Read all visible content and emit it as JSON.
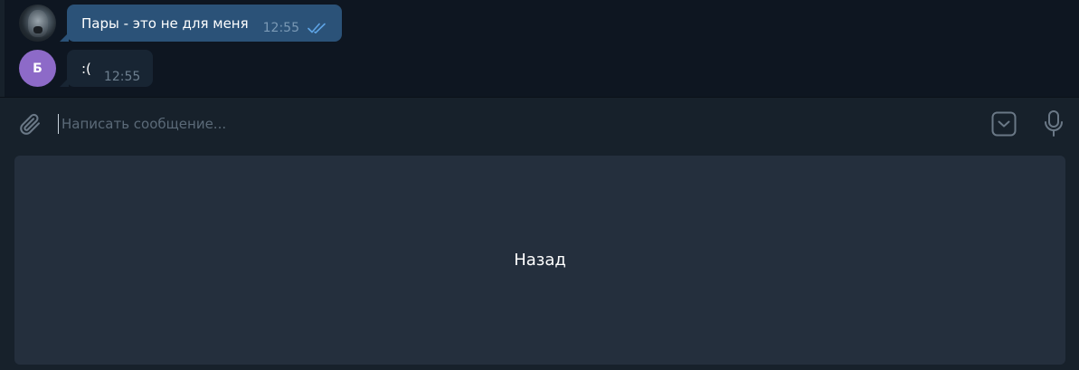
{
  "messages": [
    {
      "direction": "out",
      "text": "Пары - это не для меня",
      "time": "12:55",
      "status_icon": "double-check-icon"
    },
    {
      "direction": "in",
      "avatar_letter": "Б",
      "text": ":(",
      "time": "12:55"
    }
  ],
  "composer": {
    "placeholder": "Написать сообщение...",
    "value": "",
    "icons": [
      "attach-icon",
      "bot-keyboard-icon",
      "microphone-icon"
    ]
  },
  "keyboard": {
    "buttons": [
      {
        "label": "Назад"
      }
    ]
  },
  "colors": {
    "background": "#0e1621",
    "outgoing_bubble": "#2b5278",
    "incoming_bubble": "#182533",
    "composer": "#17212b",
    "keyboard_button": "#242f3d",
    "avatar_letter_bg": "#8d6ac8",
    "read_check": "#5ea4e6"
  }
}
